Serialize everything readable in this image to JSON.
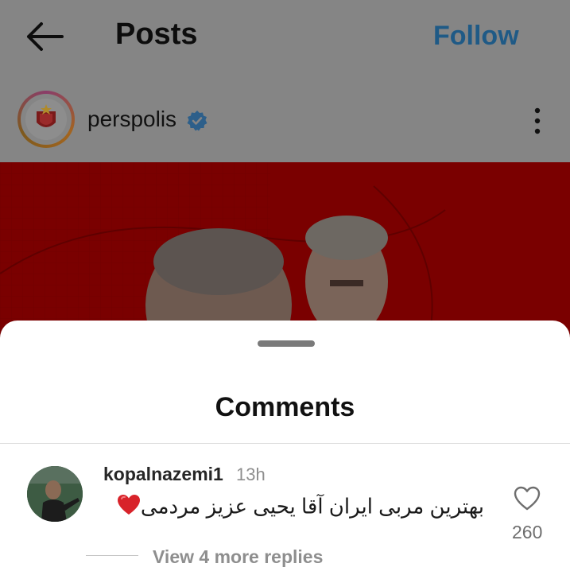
{
  "header": {
    "back_icon": "arrow-left-icon",
    "title": "Posts",
    "follow_label": "Follow",
    "follow_color": "#1f5a86"
  },
  "post": {
    "username": "perspolis",
    "verified_icon": "verified-badge-icon",
    "more_icon": "more-vertical-icon",
    "image_background": "#7a0000"
  },
  "comments_sheet": {
    "title": "Comments",
    "comments": [
      {
        "username": "kopalnazemi1",
        "time": "13h",
        "text": "بهترین مربی ایران آقا یحیی عزیز مردمی",
        "emoji": "heart-emoji",
        "likes": "260",
        "replies_label": "View 4 more replies"
      }
    ]
  }
}
